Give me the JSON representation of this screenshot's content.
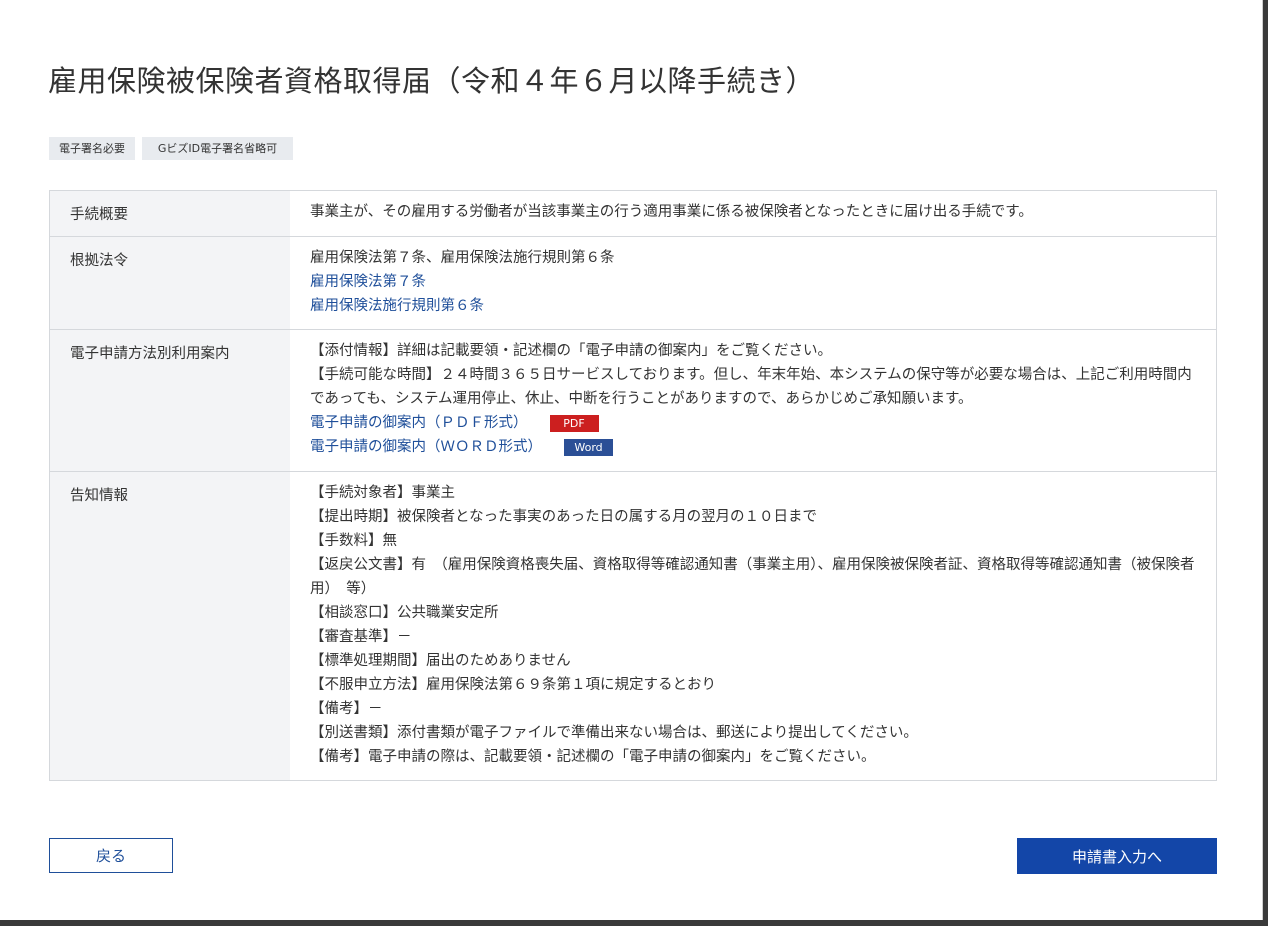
{
  "page": {
    "title": "雇用保険被保険者資格取得届（令和４年６月以降手続き）"
  },
  "tags": [
    "電子署名必要",
    "GビズID電子署名省略可"
  ],
  "table": {
    "overview": {
      "label": "手続概要",
      "text": "事業主が、その雇用する労働者が当該事業主の行う適用事業に係る被保険者となったときに届け出る手続です。"
    },
    "legal_basis": {
      "label": "根拠法令",
      "text": "雇用保険法第７条、雇用保険法施行規則第６条",
      "links": [
        "雇用保険法第７条",
        "雇用保険法施行規則第６条"
      ]
    },
    "e_application": {
      "label": "電子申請方法別利用案内",
      "line1": "【添付情報】詳細は記載要領・記述欄の「電子申請の御案内」をご覧ください。",
      "line2": "【手続可能な時間】２４時間３６５日サービスしております。但し、年末年始、本システムの保守等が必要な場合は、上記ご利用時間内であっても、システム運用停止、休止、中断を行うことがありますので、あらかじめご承知願います。",
      "link_pdf": "電子申請の御案内（ＰＤＦ形式）",
      "badge_pdf": "PDF",
      "link_word": "電子申請の御案内（ＷＯＲＤ形式）",
      "badge_word": "Word"
    },
    "notice": {
      "label": "告知情報",
      "lines": [
        "【手続対象者】事業主",
        "【提出時期】被保険者となった事実のあった日の属する月の翌月の１０日まで",
        "【手数料】無",
        "【返戻公文書】有　（雇用保険資格喪失届、資格取得等確認通知書（事業主用）、雇用保険被保険者証、資格取得等確認通知書（被保険者用）　等）",
        "【相談窓口】公共職業安定所",
        "【審査基準】－",
        "【標準処理期間】届出のためありません",
        "【不服申立方法】雇用保険法第６９条第１項に規定するとおり",
        "【備考】－",
        "【別送書類】添付書類が電子ファイルで準備出来ない場合は、郵送により提出してください。",
        "【備考】電子申請の際は、記載要領・記述欄の「電子申請の御案内」をご覧ください。"
      ]
    }
  },
  "buttons": {
    "back": "戻る",
    "next": "申請書入力へ"
  },
  "colors": {
    "link": "#1f4f9a",
    "primary": "#1346a8",
    "pdf_badge": "#cc1f1f",
    "word_badge": "#2b4f96"
  }
}
